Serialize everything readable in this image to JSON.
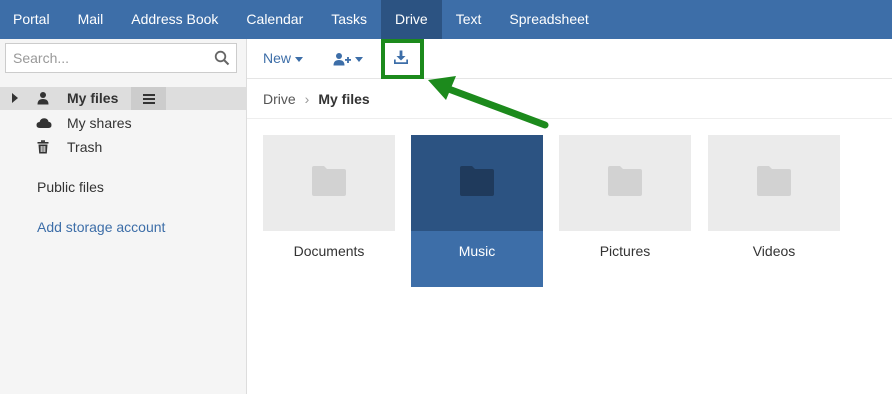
{
  "nav": {
    "items": [
      {
        "label": "Portal",
        "active": false
      },
      {
        "label": "Mail",
        "active": false
      },
      {
        "label": "Address Book",
        "active": false
      },
      {
        "label": "Calendar",
        "active": false
      },
      {
        "label": "Tasks",
        "active": false
      },
      {
        "label": "Drive",
        "active": true
      },
      {
        "label": "Text",
        "active": false
      },
      {
        "label": "Spreadsheet",
        "active": false
      }
    ]
  },
  "sidebar": {
    "search_placeholder": "Search...",
    "tree": [
      {
        "label": "My files",
        "icon": "user-icon",
        "selected": true
      },
      {
        "label": "My shares",
        "icon": "cloud-icon",
        "selected": false
      },
      {
        "label": "Trash",
        "icon": "trash-icon",
        "selected": false
      }
    ],
    "public_files": "Public files",
    "add_storage": "Add storage account"
  },
  "toolbar": {
    "new_label": "New",
    "share_icon": "add-user-icon",
    "upload_icon": "download-icon"
  },
  "breadcrumb": {
    "root": "Drive",
    "current": "My files"
  },
  "folders": [
    {
      "name": "Documents",
      "selected": false
    },
    {
      "name": "Music",
      "selected": true
    },
    {
      "name": "Pictures",
      "selected": false
    },
    {
      "name": "Videos",
      "selected": false
    }
  ],
  "colors": {
    "nav_bg": "#3d6ea8",
    "nav_active": "#2c5382",
    "highlight": "#1c8a1c",
    "link": "#3d6ea8"
  }
}
